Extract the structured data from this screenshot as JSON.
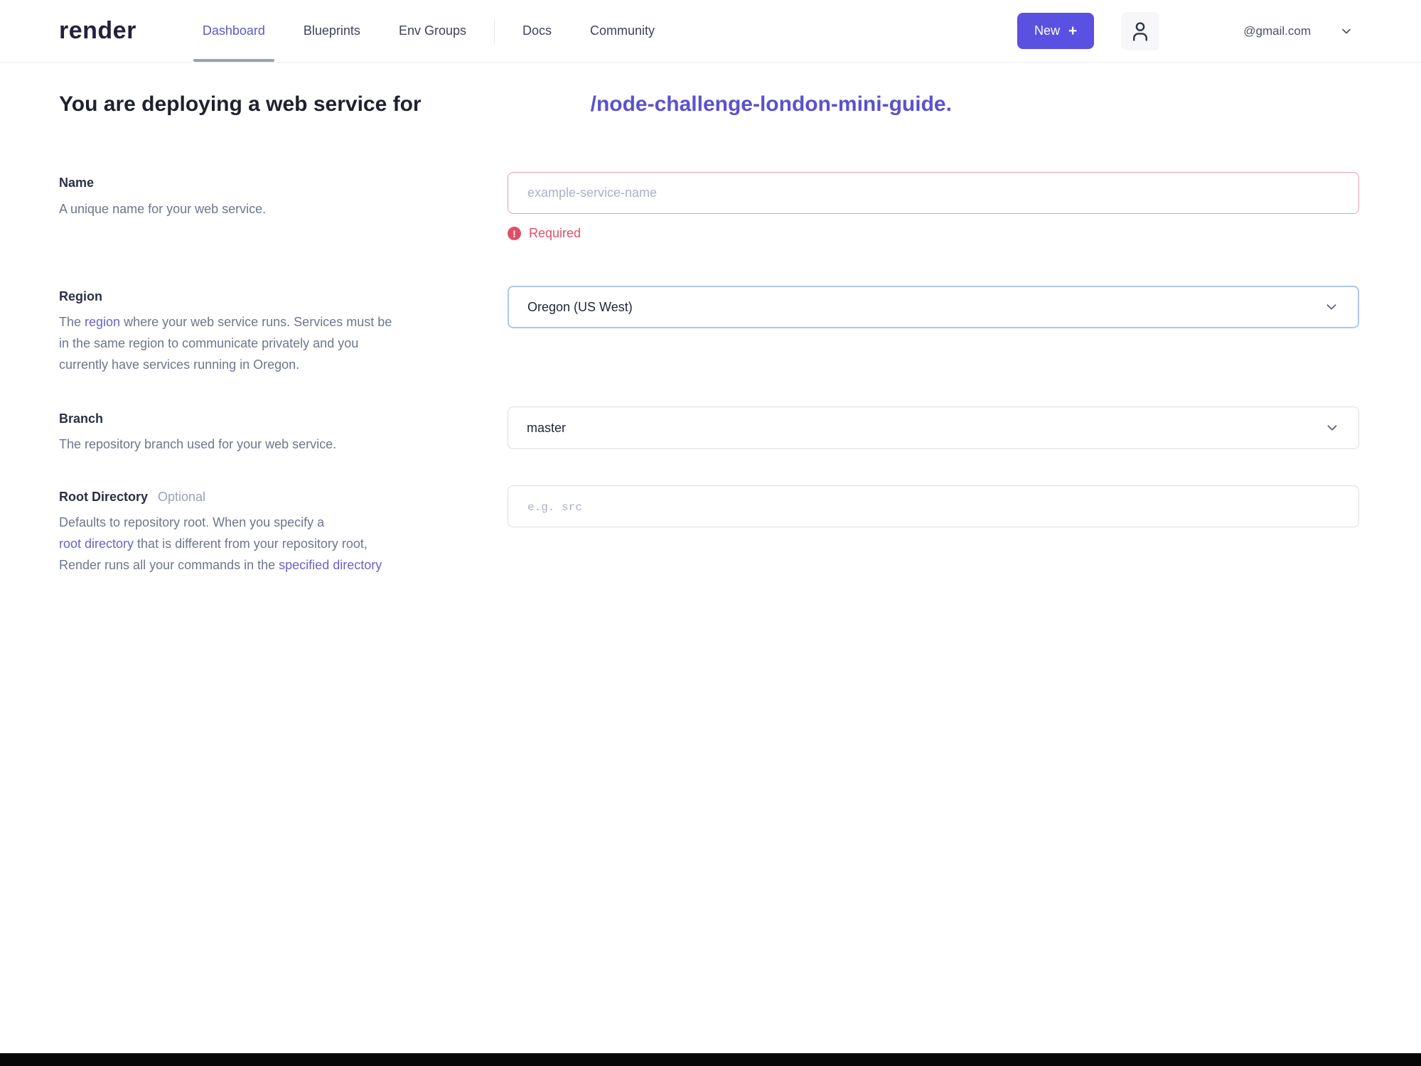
{
  "header": {
    "logo": "render",
    "nav": [
      {
        "label": "Dashboard",
        "active": true
      },
      {
        "label": "Blueprints",
        "active": false
      },
      {
        "label": "Env Groups",
        "active": false
      },
      {
        "label": "Docs",
        "active": false
      },
      {
        "label": "Community",
        "active": false
      }
    ],
    "new_button": {
      "label": "New",
      "plus": "+"
    },
    "account": {
      "email": "@gmail.com"
    }
  },
  "heading": {
    "prefix": "You are deploying a web service for",
    "repo": "/node-challenge-london-mini-guide."
  },
  "form": {
    "name": {
      "label": "Name",
      "description": "A unique name for your web service.",
      "placeholder": "example-service-name",
      "error": "Required"
    },
    "region": {
      "label": "Region",
      "value": "Oregon (US West)",
      "description_lines": [
        {
          "pre": "The ",
          "link": "region",
          "post": " where your web service runs. Services must be"
        },
        {
          "text": "in the same region to communicate privately and you"
        },
        {
          "text": "currently have services running in Oregon."
        }
      ]
    },
    "branch": {
      "label": "Branch",
      "description": "The repository branch used for your web service.",
      "value": "master"
    },
    "root_directory": {
      "label": "Root Directory",
      "optional": "Optional",
      "placeholder": "e.g. src",
      "description_lines": [
        {
          "text": "Defaults to repository root. When you specify a"
        },
        {
          "link": "root directory",
          "post": " that is different from your repository root,"
        },
        {
          "pre": "Render runs all your commands in the ",
          "link": "specified directory"
        }
      ]
    }
  },
  "colors": {
    "accent_purple": "#5a50e1",
    "active_nav_purple": "#5f57c8",
    "repo_link_purple": "#5b51cf",
    "error_pink": "#e04f66",
    "error_border": "#e7a0b0",
    "focused_select_border": "#abc8f2",
    "bottom_bar_black": "#060606"
  }
}
